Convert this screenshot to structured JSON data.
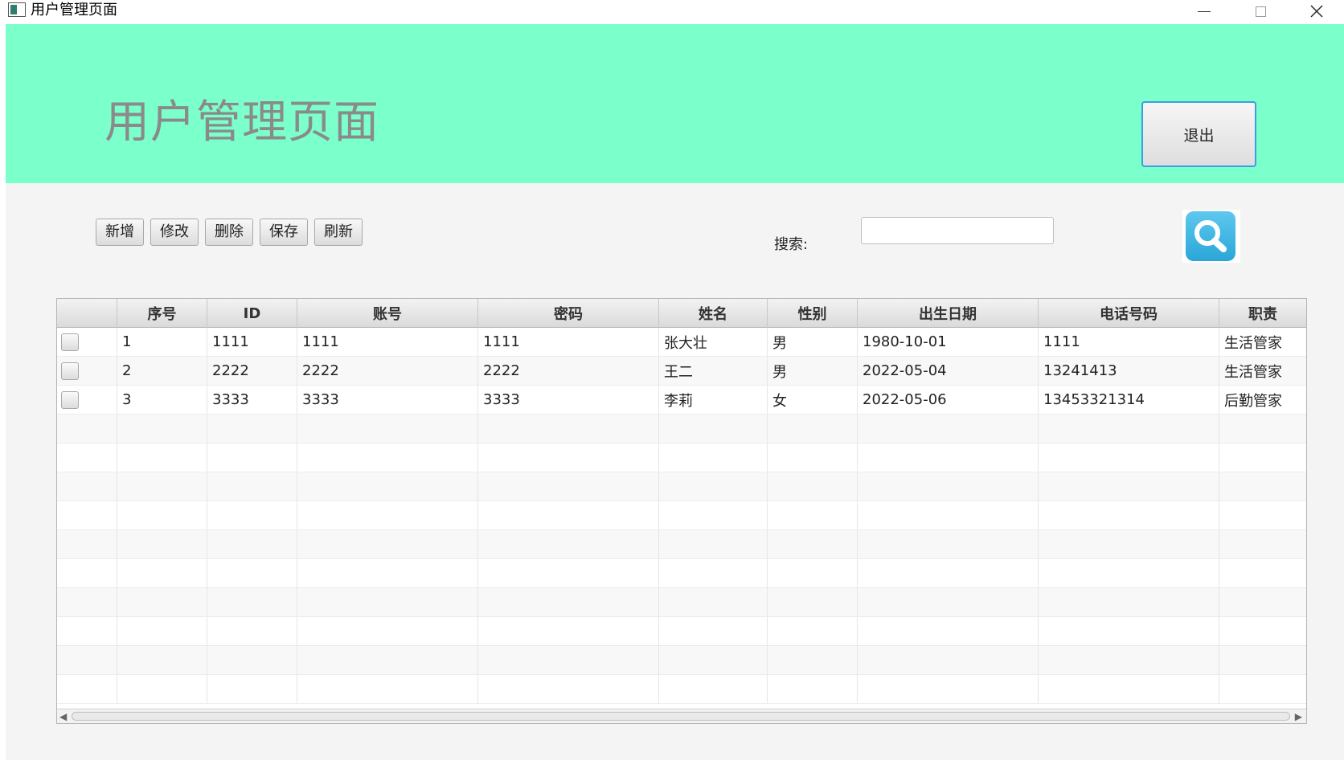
{
  "window": {
    "title": "用户管理页面"
  },
  "header": {
    "title": "用户管理页面",
    "logout_label": "退出",
    "background": "#7bffcb"
  },
  "toolbar": {
    "add_label": "新增",
    "edit_label": "修改",
    "delete_label": "删除",
    "save_label": "保存",
    "refresh_label": "刷新"
  },
  "search": {
    "label": "搜索:",
    "value": "",
    "button_icon": "magnifier-icon"
  },
  "table": {
    "columns": [
      "",
      "序号",
      "ID",
      "账号",
      "密码",
      "姓名",
      "性别",
      "出生日期",
      "电话号码",
      "职责"
    ],
    "rows": [
      {
        "index": "1",
        "id": "1111",
        "account": "1111",
        "password": "1111",
        "name": "张大壮",
        "gender": "男",
        "birth": "1980-10-01",
        "phone": "1111",
        "duty": "生活管家"
      },
      {
        "index": "2",
        "id": "2222",
        "account": "2222",
        "password": "2222",
        "name": "王二",
        "gender": "男",
        "birth": "2022-05-04",
        "phone": "13241413",
        "duty": "生活管家"
      },
      {
        "index": "3",
        "id": "3333",
        "account": "3333",
        "password": "3333",
        "name": "李莉",
        "gender": "女",
        "birth": "2022-05-06",
        "phone": "13453321314",
        "duty": "后勤管家"
      }
    ]
  }
}
